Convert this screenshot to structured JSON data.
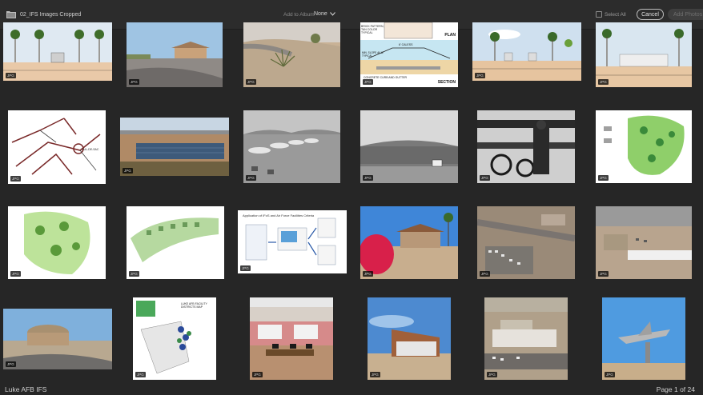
{
  "header": {
    "title": "02_IFS Images Cropped",
    "add_to_album_label": "Add to Album",
    "album_value": "None",
    "select_all_label": "Select All",
    "cancel_label": "Cancel",
    "add_photos_label": "Add Photos"
  },
  "grid": {
    "badge_label": "JPG",
    "images": [
      {
        "subject": "gateway-elevation"
      },
      {
        "subject": "gate-road"
      },
      {
        "subject": "desert-landscaping"
      },
      {
        "subject": "curb-section-detail",
        "texts": [
          "BRICK PATTERN, TAN COLOR TYPICAL",
          "PLAN",
          "6' CALESS",
          "MIN. SLOPE @ 12 TYPICAL",
          "CONCRETE CURB AND GUTTER",
          "SECTION"
        ]
      },
      {
        "subject": "gateway-elevation-2"
      },
      {
        "subject": "gateway-elevation-3"
      },
      {
        "subject": "road-network-map",
        "texts": [
          "CUL-DE-SAC"
        ]
      },
      {
        "subject": "solar-field-aerial"
      },
      {
        "subject": "flightline-jets"
      },
      {
        "subject": "hangar-building"
      },
      {
        "subject": "biplane-pilot"
      },
      {
        "subject": "site-plan-green"
      },
      {
        "subject": "campus-plan-green"
      },
      {
        "subject": "housing-site-plan"
      },
      {
        "subject": "ifs-flowchart",
        "texts": [
          "Application of IFoS and Air Force Facilities Criteria"
        ]
      },
      {
        "subject": "pavilion-bougainvillea"
      },
      {
        "subject": "parking-aerial"
      },
      {
        "subject": "shade-structure-aerial"
      },
      {
        "subject": "domed-building"
      },
      {
        "subject": "facility-districts-map",
        "texts": [
          "LUKE AFB FACILITY DISTRICTS MAP"
        ]
      },
      {
        "subject": "office-interior"
      },
      {
        "subject": "modern-building"
      },
      {
        "subject": "base-aerial"
      },
      {
        "subject": "jet-monument"
      }
    ]
  },
  "footer": {
    "album_name": "Luke AFB IFS",
    "page_indicator": "Page 1 of 24"
  }
}
